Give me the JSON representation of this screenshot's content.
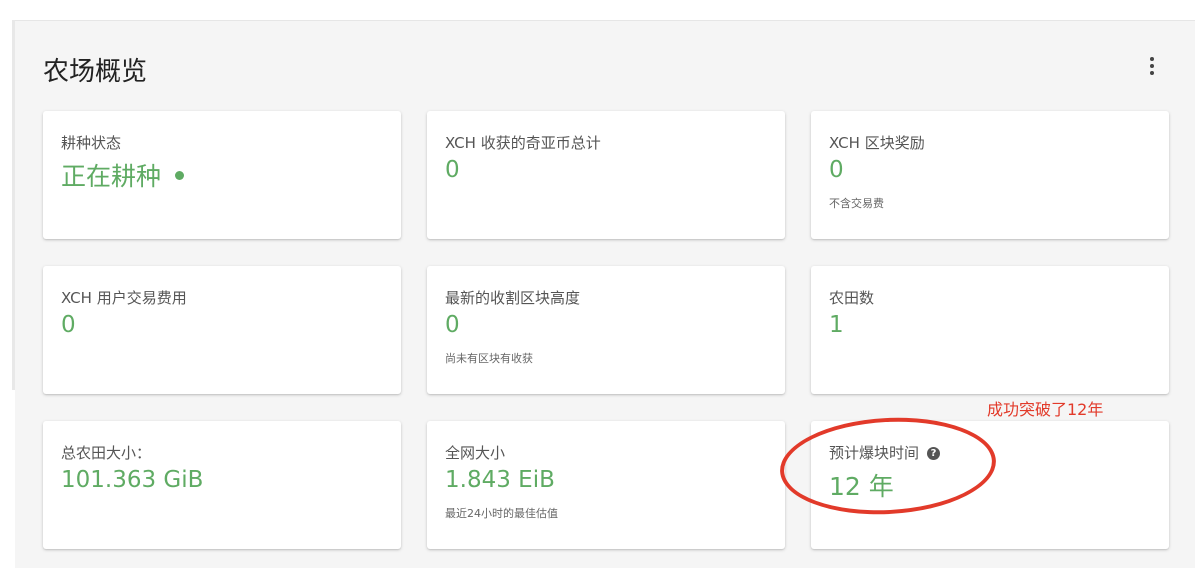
{
  "panel": {
    "title": "农场概览",
    "more_icon": "more-vert-icon"
  },
  "colors": {
    "accent_green": "#5fab63",
    "annotation_red": "#e23a2a"
  },
  "cards": [
    {
      "label": "耕种状态",
      "value": "正在耕种",
      "status_icon": "status-dot-icon"
    },
    {
      "label": "XCH 收获的奇亚币总计",
      "value": "0"
    },
    {
      "label": "XCH 区块奖励",
      "value": "0",
      "note": "不含交易费"
    },
    {
      "label": "XCH 用户交易费用",
      "value": "0"
    },
    {
      "label": "最新的收割区块高度",
      "value": "0",
      "note": "尚未有区块有收获"
    },
    {
      "label": "农田数",
      "value": "1"
    },
    {
      "label": "总农田大小：",
      "value": "101.363 GiB"
    },
    {
      "label": "全网大小",
      "value": "1.843 EiB",
      "note": "最近24小时的最佳估值"
    },
    {
      "label": "预计爆块时间",
      "value": "12 年",
      "help_icon": "help-circle-icon"
    }
  ],
  "annotation": {
    "text": "成功突破了12年"
  }
}
